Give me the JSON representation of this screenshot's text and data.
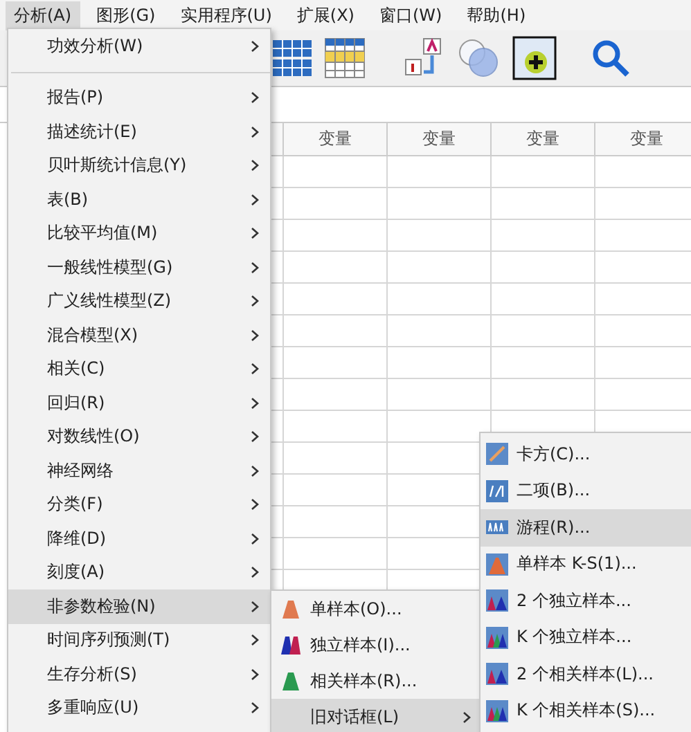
{
  "menubar": [
    {
      "label": "分析(A)",
      "selected": true
    },
    {
      "label": "图形(G)",
      "selected": false
    },
    {
      "label": "实用程序(U)",
      "selected": false
    },
    {
      "label": "扩展(X)",
      "selected": false
    },
    {
      "label": "窗口(W)",
      "selected": false
    },
    {
      "label": "帮助(H)",
      "selected": false
    }
  ],
  "grid": {
    "columns": [
      "变量",
      "变量",
      "变量",
      "变量"
    ]
  },
  "analyze_menu": [
    {
      "label": "功效分析(W)",
      "selected": false,
      "separator_after": true
    },
    {
      "label": "报告(P)",
      "selected": false
    },
    {
      "label": "描述统计(E)",
      "selected": false
    },
    {
      "label": "贝叶斯统计信息(Y)",
      "selected": false
    },
    {
      "label": "表(B)",
      "selected": false
    },
    {
      "label": "比较平均值(M)",
      "selected": false
    },
    {
      "label": "一般线性模型(G)",
      "selected": false
    },
    {
      "label": "广义线性模型(Z)",
      "selected": false
    },
    {
      "label": "混合模型(X)",
      "selected": false
    },
    {
      "label": "相关(C)",
      "selected": false
    },
    {
      "label": "回归(R)",
      "selected": false
    },
    {
      "label": "对数线性(O)",
      "selected": false
    },
    {
      "label": "神经网络",
      "selected": false
    },
    {
      "label": "分类(F)",
      "selected": false
    },
    {
      "label": "降维(D)",
      "selected": false
    },
    {
      "label": "刻度(A)",
      "selected": false
    },
    {
      "label": "非参数检验(N)",
      "selected": true
    },
    {
      "label": "时间序列预测(T)",
      "selected": false
    },
    {
      "label": "生存分析(S)",
      "selected": false
    },
    {
      "label": "多重响应(U)",
      "selected": false
    }
  ],
  "nonparametric_menu": [
    {
      "label": "单样本(O)...",
      "kind": "one-sample",
      "selected": false
    },
    {
      "label": "独立样本(I)...",
      "kind": "independent",
      "selected": false
    },
    {
      "label": "相关样本(R)...",
      "kind": "related",
      "selected": false
    },
    {
      "label": "旧对话框(L)",
      "kind": "submenu",
      "selected": true
    }
  ],
  "legacy_menu": [
    {
      "label": "卡方(C)...",
      "kind": "chi",
      "selected": false
    },
    {
      "label": "二项(B)...",
      "kind": "binomial",
      "selected": false
    },
    {
      "label": "游程(R)...",
      "kind": "runs",
      "selected": true
    },
    {
      "label": "单样本 K-S(1)...",
      "kind": "ks",
      "selected": false
    },
    {
      "label": "2 个独立样本...",
      "kind": "two",
      "selected": false
    },
    {
      "label": "K 个独立样本...",
      "kind": "k",
      "selected": false
    },
    {
      "label": "2 个相关样本(L)...",
      "kind": "two",
      "selected": false
    },
    {
      "label": "K 个相关样本(S)...",
      "kind": "k",
      "selected": false
    }
  ]
}
